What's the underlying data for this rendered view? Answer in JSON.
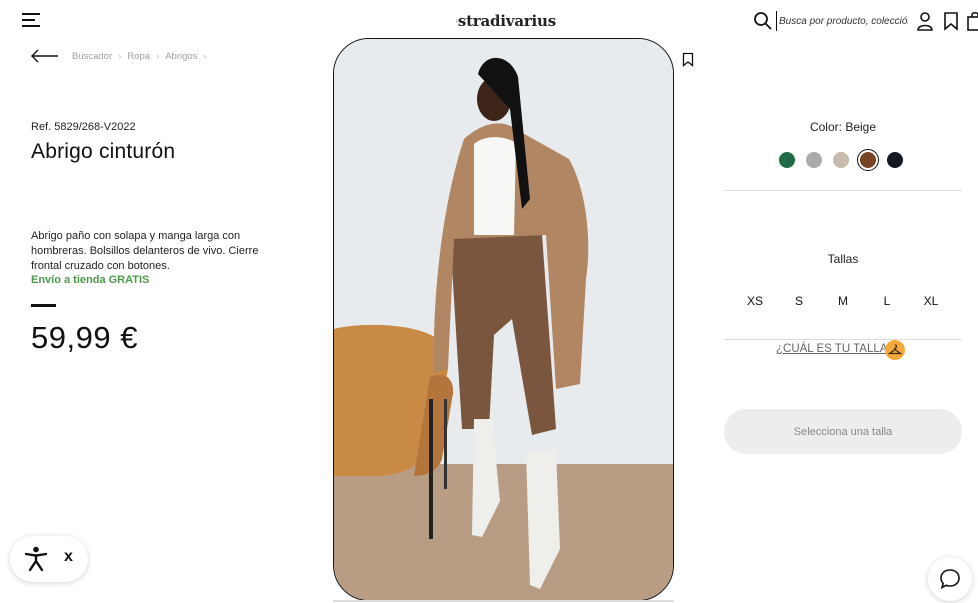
{
  "header": {
    "logo_text": "stradivarius",
    "search_placeholder": "Busca por producto, colección..."
  },
  "breadcrumb": [
    "Buscador",
    "Ropa",
    "Abrigos"
  ],
  "product": {
    "ref": "Ref. 5829/268-V2022",
    "title": "Abrigo cinturón",
    "description": "Abrigo paño con solapa y manga larga con hombreras. Bolsillos delanteros de vivo. Cierre frontal cruzado con botones.",
    "shipping": "Envío a tienda GRATIS",
    "price": "59,99 €"
  },
  "color": {
    "label": "Color: Beige",
    "swatches": [
      {
        "name": "green",
        "hex": "#1f6b45",
        "selected": false
      },
      {
        "name": "grey",
        "hex": "#a9aaac",
        "selected": false
      },
      {
        "name": "beige",
        "hex": "#c7b9ab",
        "selected": false
      },
      {
        "name": "brown",
        "hex": "#7a4426",
        "selected": true
      },
      {
        "name": "black",
        "hex": "#141820",
        "selected": false
      }
    ]
  },
  "sizes": {
    "label": "Tallas",
    "options": [
      "XS",
      "S",
      "M",
      "L",
      "XL"
    ],
    "guide_label": "¿CUÁL ES TU TALLA?"
  },
  "cta": {
    "label": "Selecciona una talla"
  },
  "accessibility": {
    "close_label": "x"
  },
  "colors": {
    "shipping_green": "#4a9a4a",
    "guide_badge": "#f4a93a",
    "button_bg": "#ededed"
  }
}
